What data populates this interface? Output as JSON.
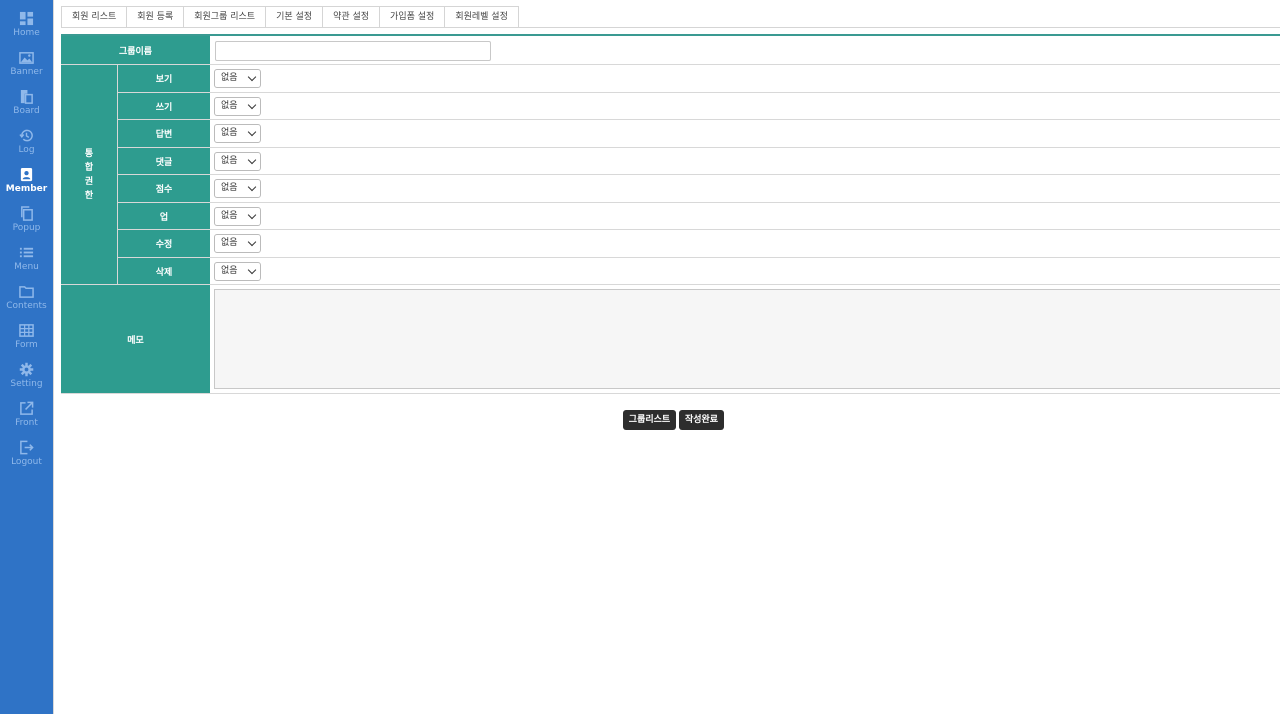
{
  "sidebar": {
    "items": [
      {
        "label": "Home",
        "icon": "grid-icon"
      },
      {
        "label": "Banner",
        "icon": "image-icon"
      },
      {
        "label": "Board",
        "icon": "document-icon"
      },
      {
        "label": "Log",
        "icon": "history-icon"
      },
      {
        "label": "Member",
        "icon": "member-badge-icon",
        "active": true
      },
      {
        "label": "Popup",
        "icon": "copy-icon"
      },
      {
        "label": "Menu",
        "icon": "list-icon"
      },
      {
        "label": "Contents",
        "icon": "folder-icon"
      },
      {
        "label": "Form",
        "icon": "table-icon"
      },
      {
        "label": "Setting",
        "icon": "gear-icon"
      },
      {
        "label": "Front",
        "icon": "external-link-icon"
      },
      {
        "label": "Logout",
        "icon": "logout-icon"
      }
    ]
  },
  "tabs": [
    "회원 리스트",
    "회원 등록",
    "회원그룹 리스트",
    "기본 설정",
    "약관 설정",
    "가입폼 설정",
    "회원레벨 설정"
  ],
  "form": {
    "group_name_label": "그룹이름",
    "group_name_value": "",
    "permissions_label_chars": [
      "통",
      "합",
      "권",
      "한"
    ],
    "permissions": [
      {
        "label": "보기",
        "value": "없음"
      },
      {
        "label": "쓰기",
        "value": "없음"
      },
      {
        "label": "답변",
        "value": "없음"
      },
      {
        "label": "댓글",
        "value": "없음"
      },
      {
        "label": "점수",
        "value": "없음"
      },
      {
        "label": "업",
        "value": "없음"
      },
      {
        "label": "수정",
        "value": "없음"
      },
      {
        "label": "삭제",
        "value": "없음"
      }
    ],
    "memo_label": "메모",
    "memo_value": ""
  },
  "buttons": {
    "group_list": "그룹리스트",
    "submit": "작성완료"
  },
  "colors": {
    "sidebar_bg": "#2f73c6",
    "header_cell_bg": "#2e9c8f",
    "button_bg": "#2d2d2d"
  }
}
